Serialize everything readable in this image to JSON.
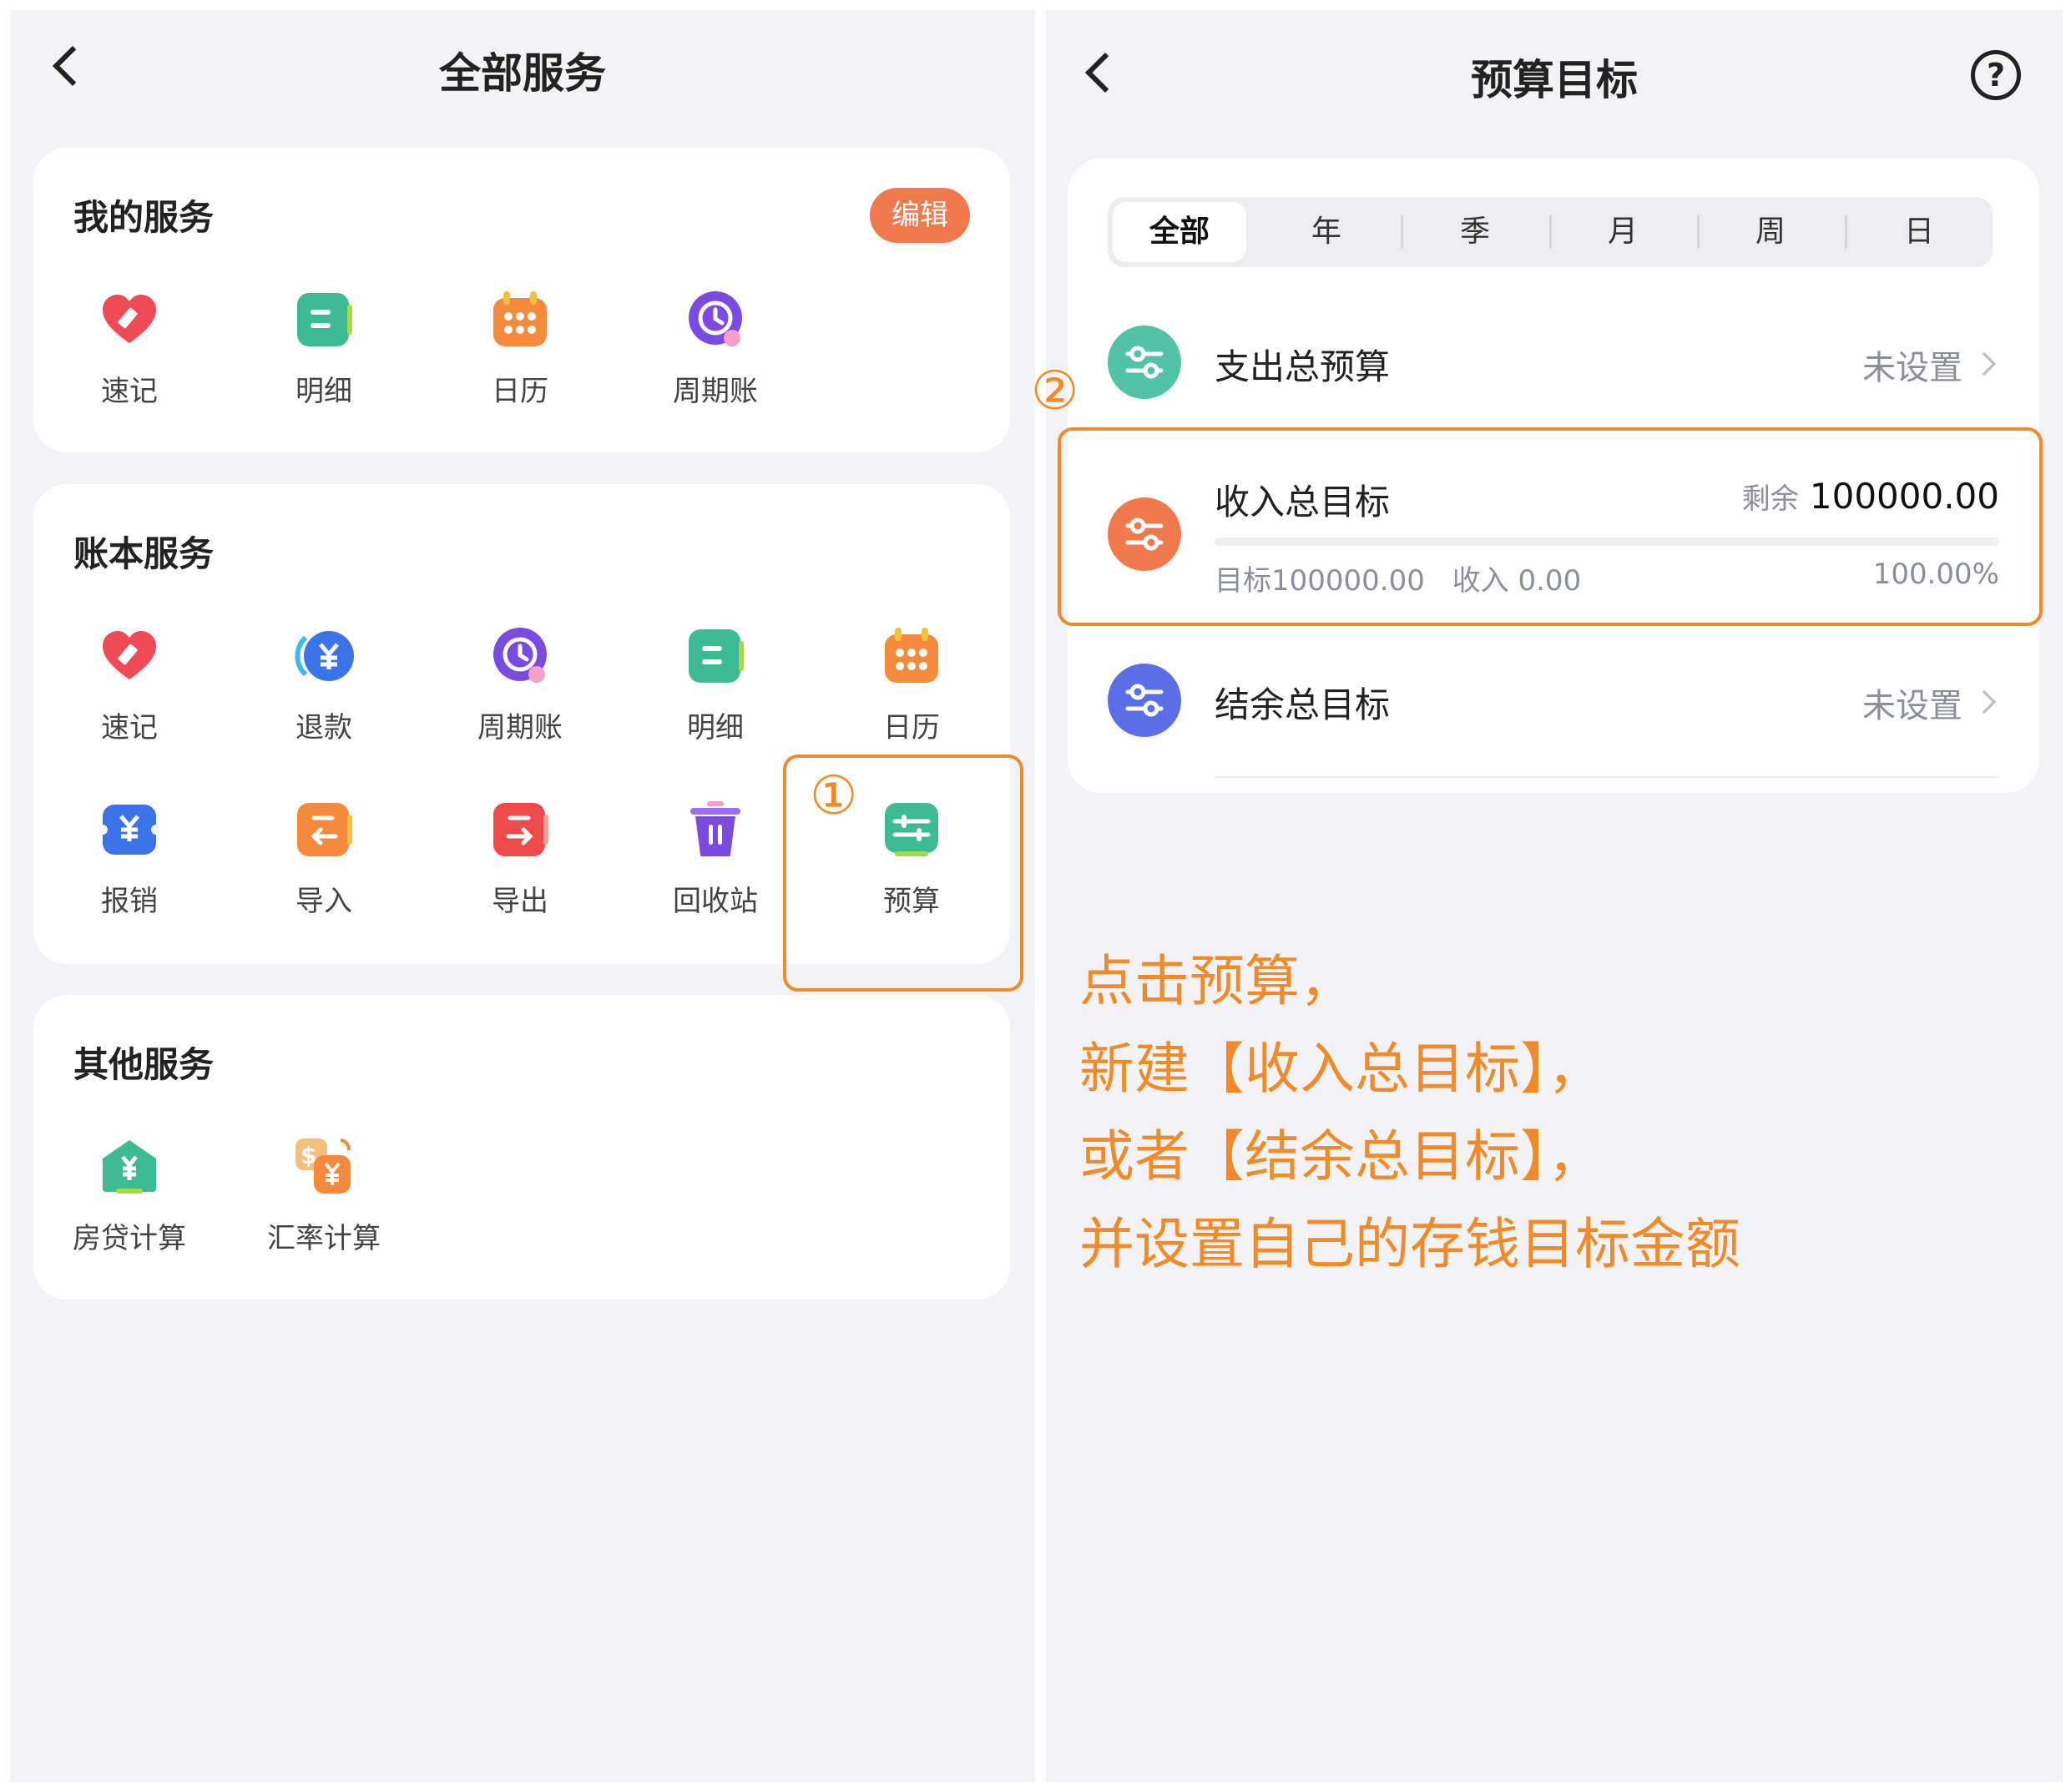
{
  "left": {
    "title": "全部服务",
    "my_services": {
      "title": "我的服务",
      "edit_label": "编辑",
      "items": [
        {
          "label": "速记",
          "icon": "heart-pen-icon"
        },
        {
          "label": "明细",
          "icon": "list-detail-icon"
        },
        {
          "label": "日历",
          "icon": "calendar-icon"
        },
        {
          "label": "周期账",
          "icon": "cycle-clock-icon"
        }
      ]
    },
    "book_services": {
      "title": "账本服务",
      "items": [
        {
          "label": "速记",
          "icon": "heart-pen-icon"
        },
        {
          "label": "退款",
          "icon": "refund-yen-icon"
        },
        {
          "label": "周期账",
          "icon": "cycle-clock-icon"
        },
        {
          "label": "明细",
          "icon": "list-detail-icon"
        },
        {
          "label": "日历",
          "icon": "calendar-icon"
        },
        {
          "label": "报销",
          "icon": "reimburse-yen-icon"
        },
        {
          "label": "导入",
          "icon": "import-arrow-icon"
        },
        {
          "label": "导出",
          "icon": "export-arrow-icon"
        },
        {
          "label": "回收站",
          "icon": "trash-bin-icon"
        },
        {
          "label": "预算",
          "icon": "budget-sliders-icon"
        }
      ]
    },
    "other_services": {
      "title": "其他服务",
      "items": [
        {
          "label": "房贷计算",
          "icon": "house-yen-icon"
        },
        {
          "label": "汇率计算",
          "icon": "exchange-rate-icon"
        }
      ]
    },
    "annotation_1": "①"
  },
  "right": {
    "title": "预算目标",
    "help_symbol": "?",
    "tabs": [
      "全部",
      "年",
      "季",
      "月",
      "周",
      "日"
    ],
    "active_tab": "全部",
    "rows": {
      "expense": {
        "label": "支出总预算",
        "status": "未设置"
      },
      "income": {
        "label": "收入总目标",
        "remaining_label": "剩余",
        "remaining_value": "100000.00",
        "target_text": "目标100000.00",
        "income_text": "收入 0.00",
        "percent": "100.00%"
      },
      "balance": {
        "label": "结余总目标",
        "status": "未设置"
      }
    },
    "annotation_2": "②",
    "instructions": [
      "点击预算，",
      "新建【收入总目标】，",
      "或者【结余总目标】，",
      "并设置自己的存钱目标金额"
    ]
  },
  "colors": {
    "accent_orange": "#f08a2a",
    "edit_button": "#f07a4e",
    "expense_icon": "#52c3a4",
    "income_icon": "#f07a4e",
    "balance_icon": "#5b6ee8"
  }
}
